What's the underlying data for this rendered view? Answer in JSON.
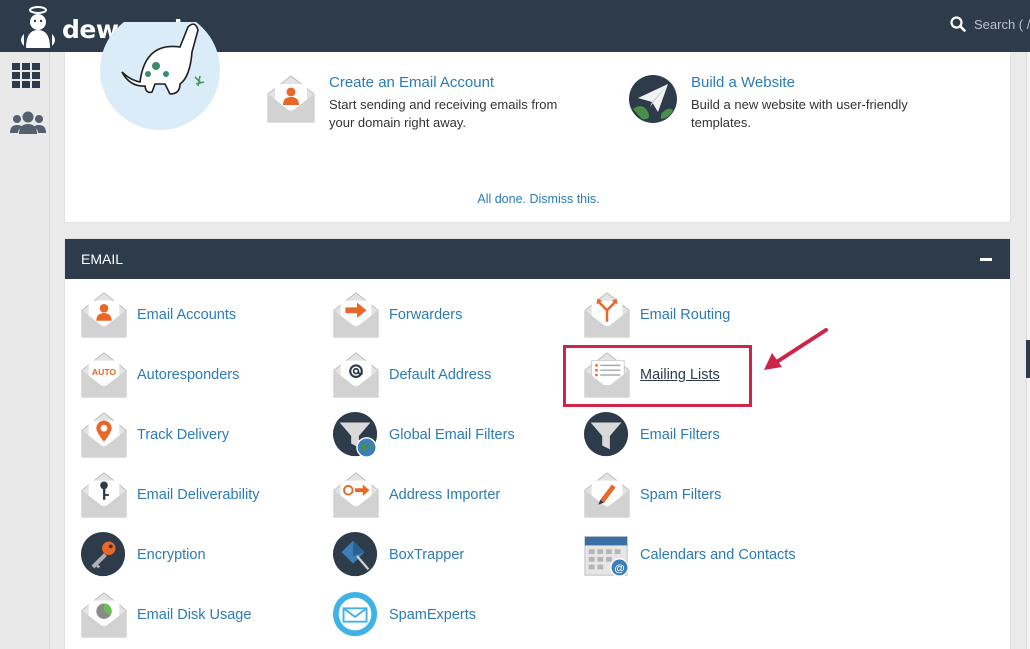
{
  "topbar": {
    "brand": "dewaweb",
    "search_placeholder": "Search ( /"
  },
  "sidebar": {
    "items": [
      {
        "icon": "grid-icon"
      },
      {
        "icon": "users-icon"
      }
    ]
  },
  "welcome": {
    "promos": [
      {
        "title": "Create an Email Account",
        "desc": "Start sending and receiving emails from your domain right away.",
        "icon": "email-account-icon"
      },
      {
        "title": "Build a Website",
        "desc": "Build a new website with user-friendly templates.",
        "icon": "paper-plane-globe-icon"
      }
    ],
    "dismiss": "All done. Dismiss this."
  },
  "email_panel": {
    "title": "EMAIL",
    "items": [
      {
        "label": "Email Accounts",
        "icon": "email-accounts-icon"
      },
      {
        "label": "Forwarders",
        "icon": "forwarders-icon"
      },
      {
        "label": "Email Routing",
        "icon": "email-routing-icon"
      },
      {
        "label": "Autoresponders",
        "icon": "autoresponders-icon"
      },
      {
        "label": "Default Address",
        "icon": "default-address-icon"
      },
      {
        "label": "Mailing Lists",
        "icon": "mailing-lists-icon"
      },
      {
        "label": "Track Delivery",
        "icon": "track-delivery-icon"
      },
      {
        "label": "Global Email Filters",
        "icon": "global-filters-icon"
      },
      {
        "label": "Email Filters",
        "icon": "email-filters-icon"
      },
      {
        "label": "Email Deliverability",
        "icon": "deliverability-icon"
      },
      {
        "label": "Address Importer",
        "icon": "address-importer-icon"
      },
      {
        "label": "Spam Filters",
        "icon": "spam-filters-icon"
      },
      {
        "label": "Encryption",
        "icon": "encryption-icon"
      },
      {
        "label": "BoxTrapper",
        "icon": "boxtrapper-icon"
      },
      {
        "label": "Calendars and Contacts",
        "icon": "calendars-icon"
      },
      {
        "label": "Email Disk Usage",
        "icon": "disk-usage-icon"
      },
      {
        "label": "SpamExperts",
        "icon": "spamexperts-icon"
      }
    ],
    "auto_badge": "AUTO"
  },
  "colors": {
    "topbar": "#2e3b4b",
    "link": "#2a7bb8",
    "highlight": "#d0234a",
    "accent_orange": "#e8682a"
  }
}
